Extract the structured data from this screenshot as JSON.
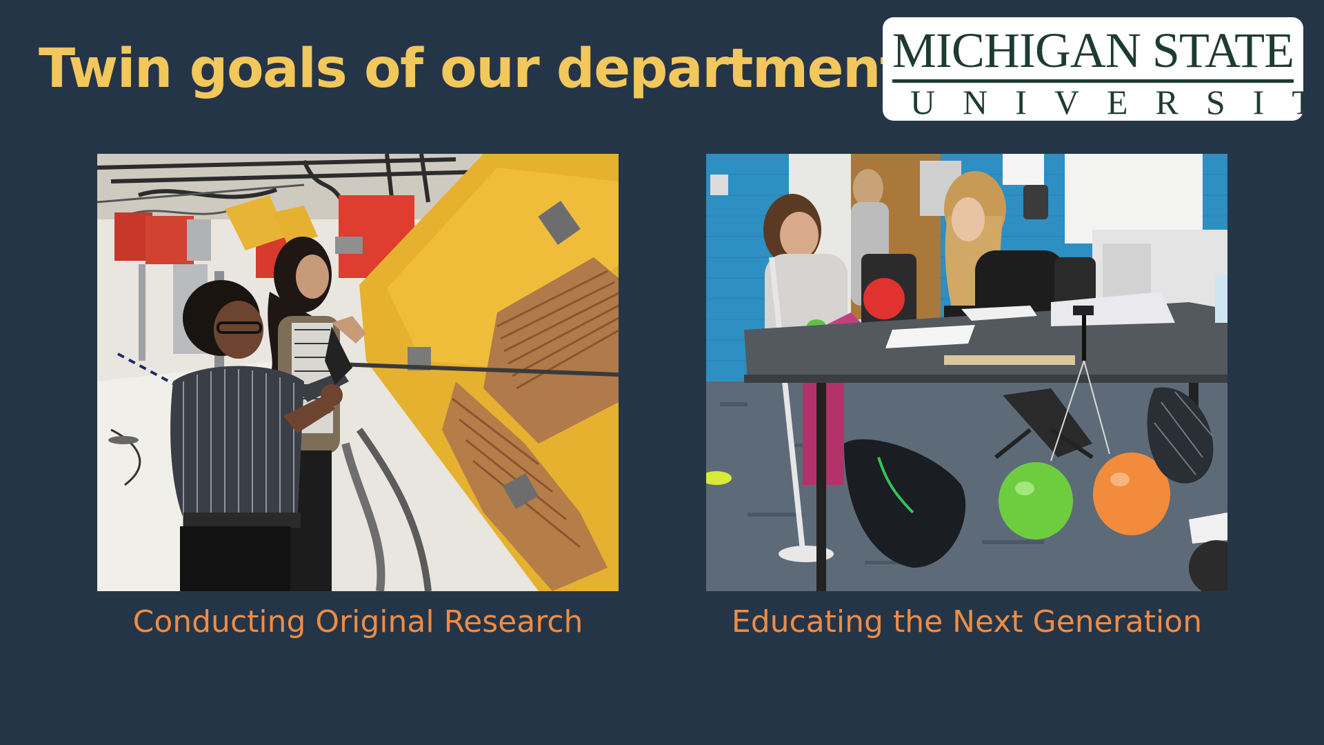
{
  "slide": {
    "title": "Twin goals of our department"
  },
  "logo": {
    "line1": "MICHIGAN STATE",
    "line2": "UNIVERSITY"
  },
  "panels": [
    {
      "caption": "Conducting Original Research",
      "photo_alt": "research-lab-photo"
    },
    {
      "caption": "Educating the Next Generation",
      "photo_alt": "classroom-photo"
    }
  ],
  "colors": {
    "background": "#253548",
    "title": "#f2c75c",
    "caption": "#ef8c45",
    "logo_text": "#1e3b32",
    "logo_bg": "#ffffff"
  }
}
